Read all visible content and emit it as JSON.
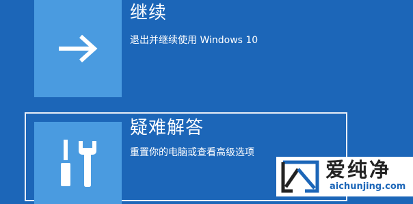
{
  "options": [
    {
      "title": "继续",
      "description": "退出并继续使用 Windows 10",
      "icon": "arrow-right-icon"
    },
    {
      "title": "疑难解答",
      "description": "重置你的电脑或查看高级选项",
      "icon": "tools-icon"
    }
  ],
  "watermark": {
    "name": "爱纯净",
    "domain": "aichunjing.com"
  },
  "colors": {
    "background": "#1c66b8",
    "tile": "#4a9be0",
    "text": "#ffffff"
  }
}
